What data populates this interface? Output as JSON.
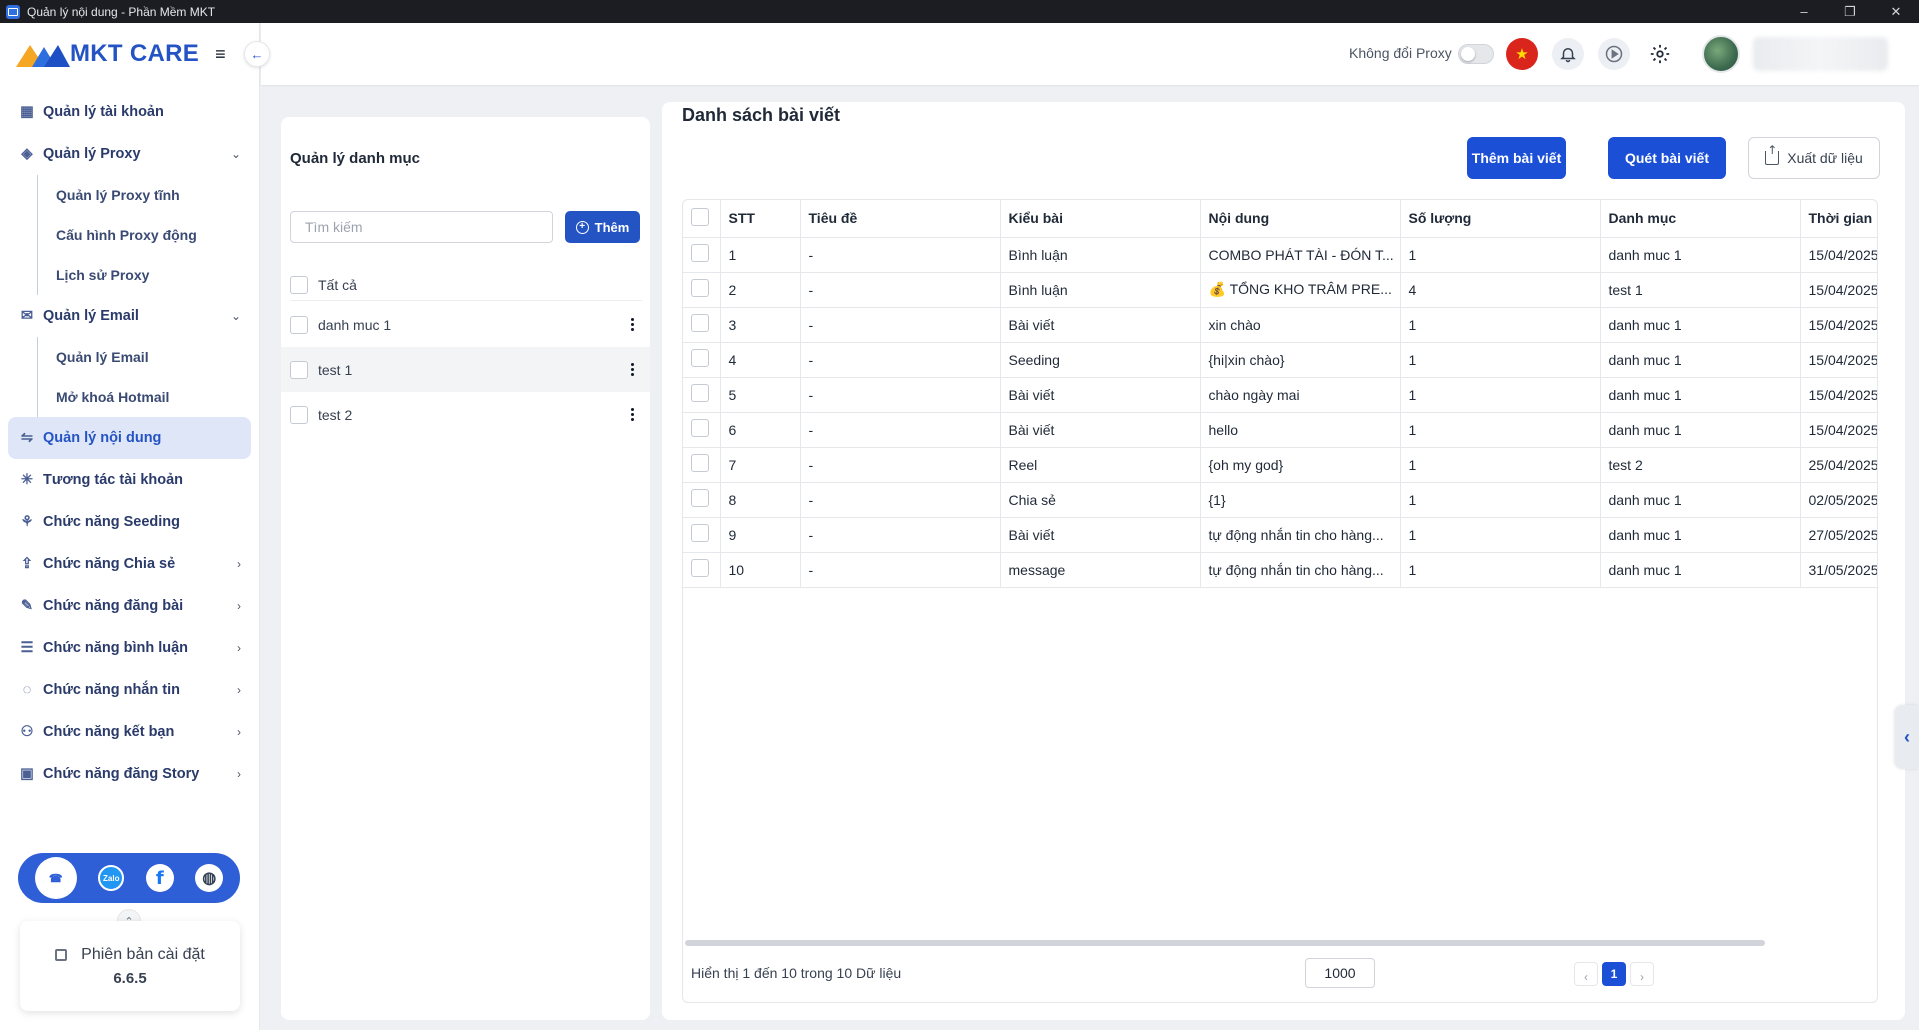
{
  "window": {
    "title": "Quản lý nội dung - Phần Mềm MKT",
    "controls": [
      "–",
      "❐",
      "✕"
    ]
  },
  "brand": {
    "name": "MKT CARE",
    "accent_color": "#2454c4"
  },
  "sidebar": {
    "items": [
      {
        "label": "Quản lý tài khoản",
        "icon": "grid-icon"
      },
      {
        "label": "Quản lý Proxy",
        "icon": "layers-icon",
        "expanded": true,
        "children": [
          "Quản lý Proxy tĩnh",
          "Cấu hình Proxy động",
          "Lịch sử Proxy"
        ]
      },
      {
        "label": "Quản lý Email",
        "icon": "mail-icon",
        "expanded": true,
        "children": [
          "Quản lý Email",
          "Mở khoá Hotmail"
        ]
      },
      {
        "label": "Quản lý nội dung",
        "icon": "content-icon",
        "active": true
      },
      {
        "label": "Tương tác tài khoản",
        "icon": "sparkle-icon"
      },
      {
        "label": "Chức năng Seeding",
        "icon": "seedling-icon"
      },
      {
        "label": "Chức năng Chia sẻ",
        "icon": "share-icon",
        "has_children": true
      },
      {
        "label": "Chức năng đăng bài",
        "icon": "post-icon",
        "has_children": true
      },
      {
        "label": "Chức năng bình luận",
        "icon": "comment-icon",
        "has_children": true
      },
      {
        "label": "Chức năng nhắn tin",
        "icon": "chat-icon",
        "has_children": true
      },
      {
        "label": "Chức năng kết bạn",
        "icon": "add-friend-icon",
        "has_children": true
      },
      {
        "label": "Chức năng đăng Story",
        "icon": "story-icon",
        "has_children": true
      }
    ],
    "support": {
      "zalo": "Zalo"
    },
    "version": {
      "label": "Phiên bản cài đặt",
      "number": "6.6.5"
    }
  },
  "header": {
    "proxy_label": "Không đổi Proxy",
    "proxy_toggle_on": false
  },
  "categories": {
    "title": "Quản lý danh mục",
    "search_placeholder": "Tìm kiếm",
    "add_label": "Thêm",
    "all_label": "Tất cả",
    "items": [
      "danh muc 1",
      "test 1",
      "test 2"
    ],
    "selected_index": 1
  },
  "posts": {
    "title": "Danh sách bài viết",
    "add_label": "Thêm bài viết",
    "scan_label": "Quét bài viết",
    "export_label": "Xuất dữ liệu",
    "columns": [
      "STT",
      "Tiêu đề",
      "Kiểu bài",
      "Nội dung",
      "Số lượng",
      "Danh mục",
      "Thời gian"
    ],
    "rows": [
      [
        "1",
        "-",
        "Bình luận",
        "COMBO PHÁT TÀI - ĐÓN T...",
        "1",
        "danh muc 1",
        "15/04/2025"
      ],
      [
        "2",
        "-",
        "Bình luận",
        "💰 TỔNG KHO TRÂM PRE...",
        "4",
        "test 1",
        "15/04/2025"
      ],
      [
        "3",
        "-",
        "Bài viết",
        "xin chào",
        "1",
        "danh muc 1",
        "15/04/2025"
      ],
      [
        "4",
        "-",
        "Seeding",
        "{hi|xin chào}",
        "1",
        "danh muc 1",
        "15/04/2025"
      ],
      [
        "5",
        "-",
        "Bài viết",
        "chào ngày mai",
        "1",
        "danh muc 1",
        "15/04/2025"
      ],
      [
        "6",
        "-",
        "Bài viết",
        "hello",
        "1",
        "danh muc 1",
        "15/04/2025"
      ],
      [
        "7",
        "-",
        "Reel",
        "{oh my god}",
        "1",
        "test 2",
        "25/04/2025"
      ],
      [
        "8",
        "-",
        "Chia sẻ",
        "{1}",
        "1",
        "danh muc 1",
        "02/05/2025"
      ],
      [
        "9",
        "-",
        "Bài viết",
        "tự động nhắn tin cho hàng...",
        "1",
        "danh muc 1",
        "27/05/2025"
      ],
      [
        "10",
        "-",
        "message",
        "tự động nhắn tin cho hàng...",
        "1",
        "danh muc 1",
        "31/05/2025"
      ]
    ],
    "footer": {
      "info": "Hiển thị 1 đến 10 trong 10 Dữ liệu",
      "page_size": "1000",
      "current_page": "1"
    }
  }
}
